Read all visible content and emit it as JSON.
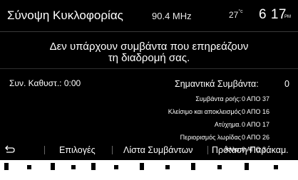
{
  "header": {
    "title": "Σύνοψη Κυκλοφορίας",
    "frequency": "90.4 MHz",
    "temperature": "27",
    "temperature_unit": "°c",
    "time": "6 17",
    "ampm": "PM"
  },
  "message": {
    "line1": "Δεν υπάρχουν συμβάντα που επηρεάζουν",
    "line2": "τη διαδρομή σας."
  },
  "summary": {
    "delay_label": "Συν. Καθυστ.: 0:00",
    "main_label": "Σημαντικά Συμβάντα:",
    "main_value": "0"
  },
  "rows": [
    {
      "label": "Συμβάντα ροής:",
      "value": "0 ΑΠΟ 37"
    },
    {
      "label": "Κλείσιμο και αποκλεισμός",
      "value": "0 ΑΠΟ 16"
    },
    {
      "label": "Ατύχημα.",
      "value": "0 ΑΠΟ 17"
    },
    {
      "label": "Περιορισμός λωρίδας",
      "value": "0 ΑΠΟ 26"
    },
    {
      "label": "Άλλα:",
      "value": "0 ΑΠΟ 3"
    }
  ],
  "footer": {
    "back_icon": "back-arrow-icon",
    "options": "Επιλογές",
    "events_list": "Λίστα Συμβάντων",
    "suggest_detour": "Πρόταση Παράκαμ."
  }
}
